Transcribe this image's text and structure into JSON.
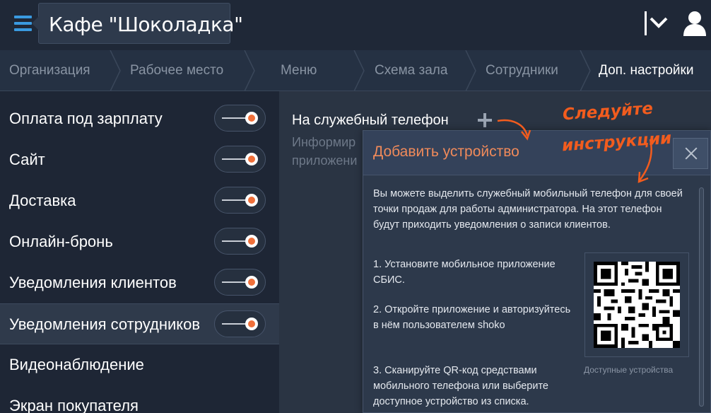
{
  "header": {
    "title": "Кафе \"Шоколадка\"",
    "accent_color": "#3a9ae0"
  },
  "tabs": [
    {
      "label": "Организация"
    },
    {
      "label": "Рабочее место"
    },
    {
      "label": "Меню"
    },
    {
      "label": "Схема зала"
    },
    {
      "label": "Сотрудники"
    },
    {
      "label": "Доп. настройки",
      "active": true
    }
  ],
  "sidebar": {
    "items": [
      {
        "label": "Оплата под зарплату",
        "toggle": true
      },
      {
        "label": "Сайт",
        "toggle": true
      },
      {
        "label": "Доставка",
        "toggle": true
      },
      {
        "label": "Онлайн-бронь",
        "toggle": true
      },
      {
        "label": "Уведомления клиентов",
        "toggle": true
      },
      {
        "label": "Уведомления сотрудников",
        "toggle": true,
        "active": true
      },
      {
        "label": "Видеонаблюдение"
      },
      {
        "label": "Экран покупателя"
      }
    ],
    "toggle_accent": "#f0703a"
  },
  "main": {
    "title": "На служебный телефон",
    "subtitle_lines": [
      "Информир",
      "приложени"
    ]
  },
  "dialog": {
    "title": "Добавить устройство",
    "intro": "Вы можете выделить служебный мобильный телефон для своей точки продаж для работы администратора. На этот телефон будут приходить уведомления о записи клиентов.",
    "steps": [
      "1. Установите мобильное приложение СБИС.",
      "2. Откройте приложение и авторизуйтесь в нём пользователем shoko",
      "3. Сканируйте QR-код средствами мобильного телефона или выберите доступное устройство из списка."
    ],
    "qr_caption": "Доступные устройства",
    "title_color": "#f08a5a"
  },
  "annotation": {
    "line1": "Следуйте",
    "line2": "инструкции",
    "color": "#f25c1e"
  }
}
